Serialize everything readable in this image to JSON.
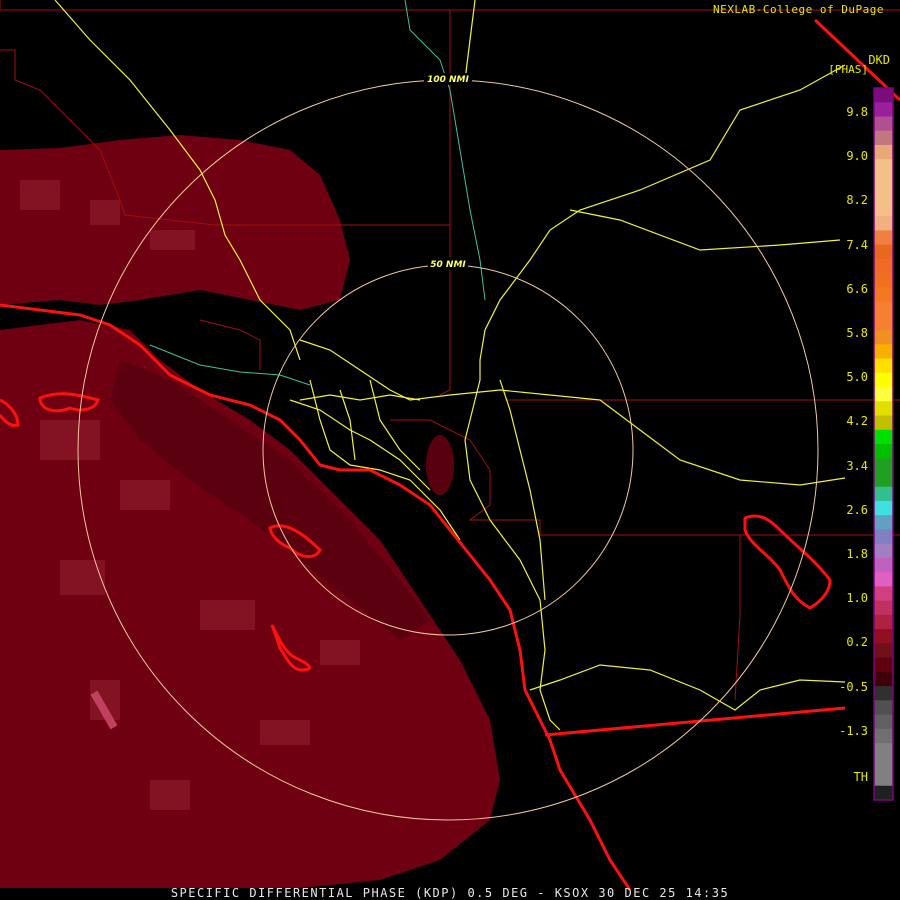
{
  "credit": "NEXLAB-College of DuPage",
  "product": {
    "code": "DKD",
    "units": "[PHAS]"
  },
  "footer": "SPECIFIC DIFFERENTIAL PHASE (KDP) 0.5 DEG - KSOX 30 DEC 25 14:35",
  "range_rings": [
    {
      "label": "100 NMI"
    },
    {
      "label": "50 NMI"
    }
  ],
  "legend": {
    "labels": [
      "9.8",
      "9.0",
      "8.2",
      "7.4",
      "6.6",
      "5.8",
      "5.0",
      "4.2",
      "3.4",
      "2.6",
      "1.8",
      "1.0",
      "0.2",
      "-0.5",
      "-1.3",
      "TH"
    ],
    "colors": [
      "#7a0d7a",
      "#9a1f9a",
      "#b05090",
      "#c07880",
      "#e8a878",
      "#f4c088",
      "#f4c088",
      "#f4c088",
      "#f4c088",
      "#f0b080",
      "#f08040",
      "#e86820",
      "#f06a28",
      "#f07020",
      "#f47820",
      "#f48030",
      "#f48030",
      "#f09020",
      "#f8b000",
      "#ffe000",
      "#ffff00",
      "#ffff40",
      "#e0e000",
      "#c0c000",
      "#00e000",
      "#00c000",
      "#20a020",
      "#20a020",
      "#30c090",
      "#40e0e0",
      "#60a0c0",
      "#8080c0",
      "#a080c0",
      "#c060c0",
      "#e060c0",
      "#d04080",
      "#c03060",
      "#b02040",
      "#901020",
      "#701018",
      "#600010",
      "#400008",
      "#303030",
      "#505050",
      "#606060",
      "#707070",
      "#808080",
      "#808080",
      "#808080",
      "#202020"
    ],
    "border": "#800080"
  },
  "colors": {
    "echo": "#7a0014",
    "echo_light": "#8c1a2a",
    "coast": "#ff1010",
    "county": "#a01010",
    "highway": "#f0f040",
    "river": "#40c0a0",
    "ring": "#f0c8a0"
  }
}
